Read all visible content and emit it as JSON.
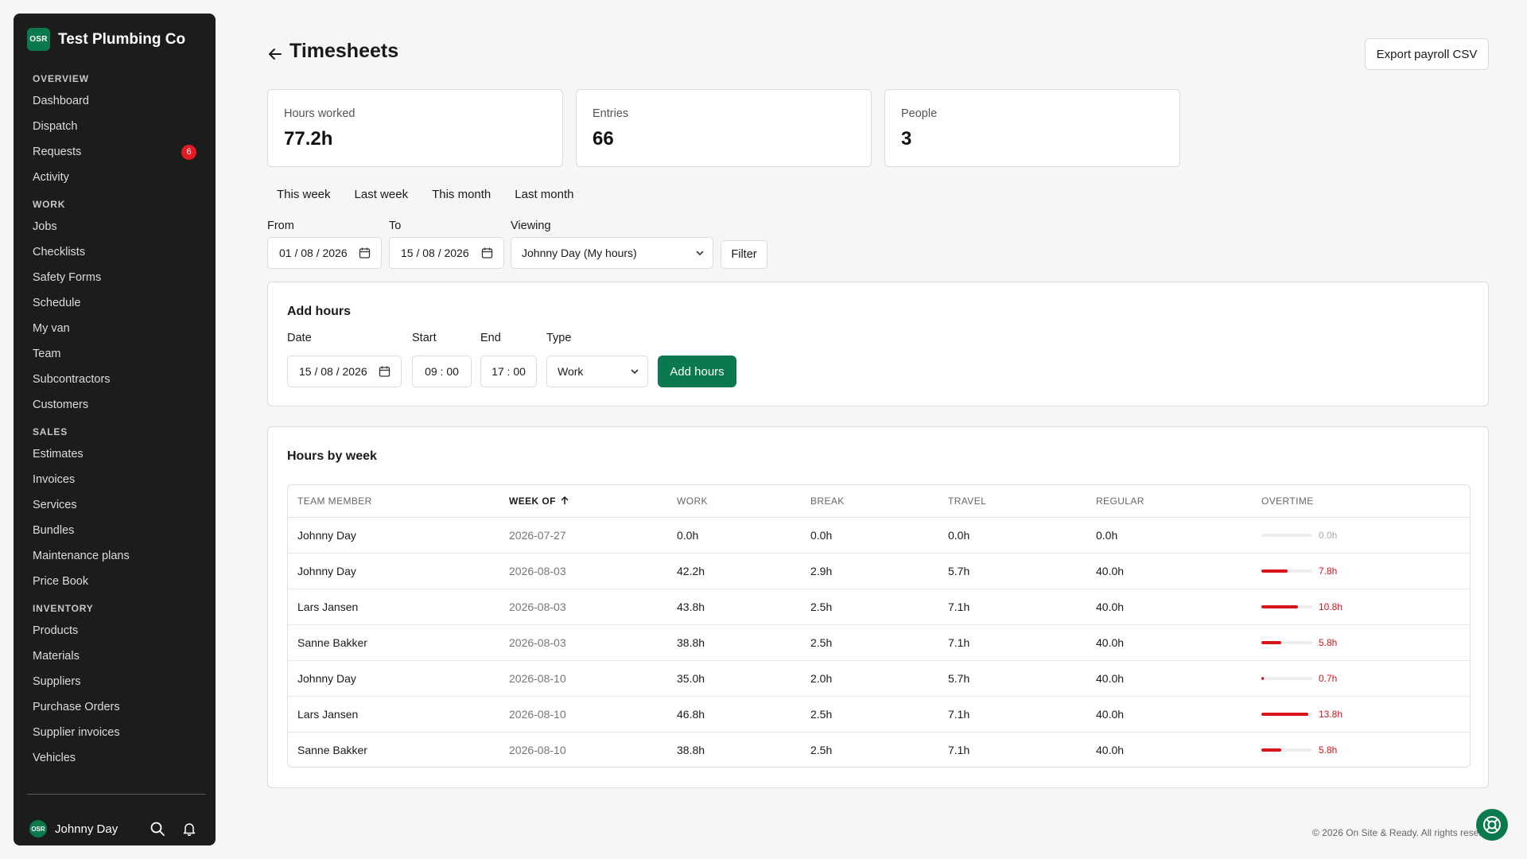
{
  "brand": {
    "logo": "OSR",
    "name": "Test Plumbing Co"
  },
  "sidebar": {
    "sections": [
      {
        "title": "OVERVIEW",
        "items": [
          {
            "label": "Dashboard"
          },
          {
            "label": "Dispatch"
          },
          {
            "label": "Requests",
            "badge": "6"
          },
          {
            "label": "Activity"
          }
        ]
      },
      {
        "title": "WORK",
        "items": [
          {
            "label": "Jobs"
          },
          {
            "label": "Checklists"
          },
          {
            "label": "Safety Forms"
          },
          {
            "label": "Schedule"
          },
          {
            "label": "My van"
          },
          {
            "label": "Team"
          },
          {
            "label": "Subcontractors"
          },
          {
            "label": "Customers"
          }
        ]
      },
      {
        "title": "SALES",
        "items": [
          {
            "label": "Estimates"
          },
          {
            "label": "Invoices"
          },
          {
            "label": "Services"
          },
          {
            "label": "Bundles"
          },
          {
            "label": "Maintenance plans"
          },
          {
            "label": "Price Book"
          }
        ]
      },
      {
        "title": "INVENTORY",
        "items": [
          {
            "label": "Products"
          },
          {
            "label": "Materials"
          },
          {
            "label": "Suppliers"
          },
          {
            "label": "Purchase Orders"
          },
          {
            "label": "Supplier invoices"
          },
          {
            "label": "Vehicles"
          }
        ]
      }
    ],
    "user": {
      "initials": "OSR",
      "name": "Johnny Day"
    },
    "icons": {
      "search": "search-icon",
      "notifications": "bell-icon"
    }
  },
  "header": {
    "title": "Timesheets",
    "export_label": "Export payroll CSV"
  },
  "stats": [
    {
      "label": "Hours worked",
      "value": "77.2h"
    },
    {
      "label": "Entries",
      "value": "66"
    },
    {
      "label": "People",
      "value": "3"
    }
  ],
  "ranges": [
    "This week",
    "Last week",
    "This month",
    "Last month"
  ],
  "filters": {
    "from_label": "From",
    "from_value": "01 / 08 / 2026",
    "to_label": "To",
    "to_value": "15 / 08 / 2026",
    "viewing_label": "Viewing",
    "viewing_value": "Johnny Day (My hours)",
    "filter_label": "Filter"
  },
  "add_hours": {
    "title": "Add hours",
    "date_label": "Date",
    "date_value": "15 / 08 / 2026",
    "start_label": "Start",
    "start_value": "09 : 00",
    "end_label": "End",
    "end_value": "17 : 00",
    "type_label": "Type",
    "type_value": "Work",
    "button_label": "Add hours"
  },
  "hours_by_week": {
    "title": "Hours by week",
    "columns": [
      "TEAM MEMBER",
      "WEEK OF",
      "WORK",
      "BREAK",
      "TRAVEL",
      "REGULAR",
      "OVERTIME"
    ],
    "rows": [
      {
        "member": "Johnny Day",
        "week": "2026-07-27",
        "work": "0.0h",
        "break": "0.0h",
        "travel": "0.0h",
        "regular": "0.0h",
        "overtime": "0.0h",
        "overtime_hours": 0.0
      },
      {
        "member": "Johnny Day",
        "week": "2026-08-03",
        "work": "42.2h",
        "break": "2.9h",
        "travel": "5.7h",
        "regular": "40.0h",
        "overtime": "7.8h",
        "overtime_hours": 7.8
      },
      {
        "member": "Lars Jansen",
        "week": "2026-08-03",
        "work": "43.8h",
        "break": "2.5h",
        "travel": "7.1h",
        "regular": "40.0h",
        "overtime": "10.8h",
        "overtime_hours": 10.8
      },
      {
        "member": "Sanne Bakker",
        "week": "2026-08-03",
        "work": "38.8h",
        "break": "2.5h",
        "travel": "7.1h",
        "regular": "40.0h",
        "overtime": "5.8h",
        "overtime_hours": 5.8
      },
      {
        "member": "Johnny Day",
        "week": "2026-08-10",
        "work": "35.0h",
        "break": "2.0h",
        "travel": "5.7h",
        "regular": "40.0h",
        "overtime": "0.7h",
        "overtime_hours": 0.7
      },
      {
        "member": "Lars Jansen",
        "week": "2026-08-10",
        "work": "46.8h",
        "break": "2.5h",
        "travel": "7.1h",
        "regular": "40.0h",
        "overtime": "13.8h",
        "overtime_hours": 13.8
      },
      {
        "member": "Sanne Bakker",
        "week": "2026-08-10",
        "work": "38.8h",
        "break": "2.5h",
        "travel": "7.1h",
        "regular": "40.0h",
        "overtime": "5.8h",
        "overtime_hours": 5.8
      }
    ]
  },
  "footer": {
    "text": "© 2026 On Site & Ready. All rights reserved."
  },
  "colors": {
    "brand": "#0a7a4e",
    "overtime": "#d7141a",
    "badge": "#e31b23",
    "sidebar": "#1c1c1c"
  }
}
